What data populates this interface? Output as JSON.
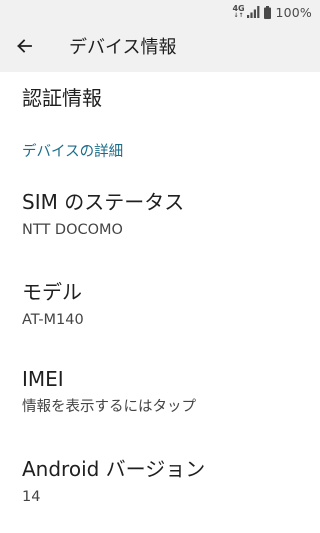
{
  "status_bar": {
    "network_type": "4G",
    "network_arrows": "↓↑",
    "battery_text": "100%",
    "signal_icon": "signal-bars-icon",
    "battery_icon": "battery-full-icon"
  },
  "app_bar": {
    "back_icon": "arrow-back-icon",
    "title": "デバイス情報"
  },
  "items": {
    "certification": {
      "title": "認証情報"
    },
    "section_device_details": "デバイスの詳細",
    "sim_status": {
      "title": "SIM のステータス",
      "summary": "NTT DOCOMO"
    },
    "model": {
      "title": "モデル",
      "summary": "AT-M140"
    },
    "imei": {
      "title": "IMEI",
      "summary": "情報を表示するにはタップ"
    },
    "android_version": {
      "title": "Android バージョン",
      "summary": "14"
    }
  },
  "colors": {
    "app_bar_bg": "#f1f1f1",
    "page_bg": "#ffffff",
    "section_header": "#1b6d8a",
    "title_text": "#1f1f1f",
    "summary_text": "#444444"
  }
}
